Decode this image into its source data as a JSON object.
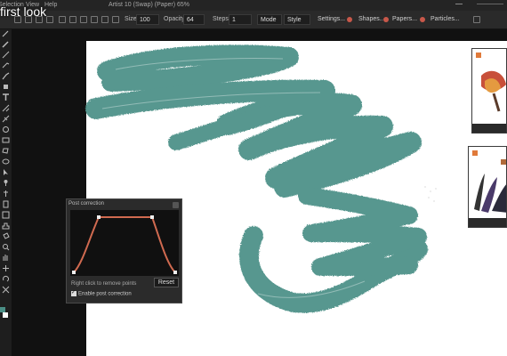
{
  "overlay_title": "first look",
  "menu": {
    "items": [
      "Selection",
      "View",
      "Help"
    ]
  },
  "window_title": "Artist 10 (Swap) (Paper) 65%",
  "toolbar": {
    "size_label": "Size",
    "size_value": "100",
    "opacity_label": "Opacity",
    "opacity_value": "64",
    "steps_label": "Steps",
    "steps_value": "1",
    "mode_label": "Mode",
    "style_label": "Style",
    "settings_label": "Settings...",
    "shapes_label": "Shapes...",
    "papers_label": "Papers...",
    "particles_label": "Particles..."
  },
  "post_correction": {
    "title": "Post correction",
    "hint": "Right click to remove points",
    "reset_label": "Reset",
    "enable_label": "Enable post correction",
    "enabled": true
  },
  "colors": {
    "accent": "#c8584a",
    "stroke": "#4a8f86",
    "curve": "#d06a50",
    "background": "#1b1b1b",
    "paper": "#ffffff"
  }
}
